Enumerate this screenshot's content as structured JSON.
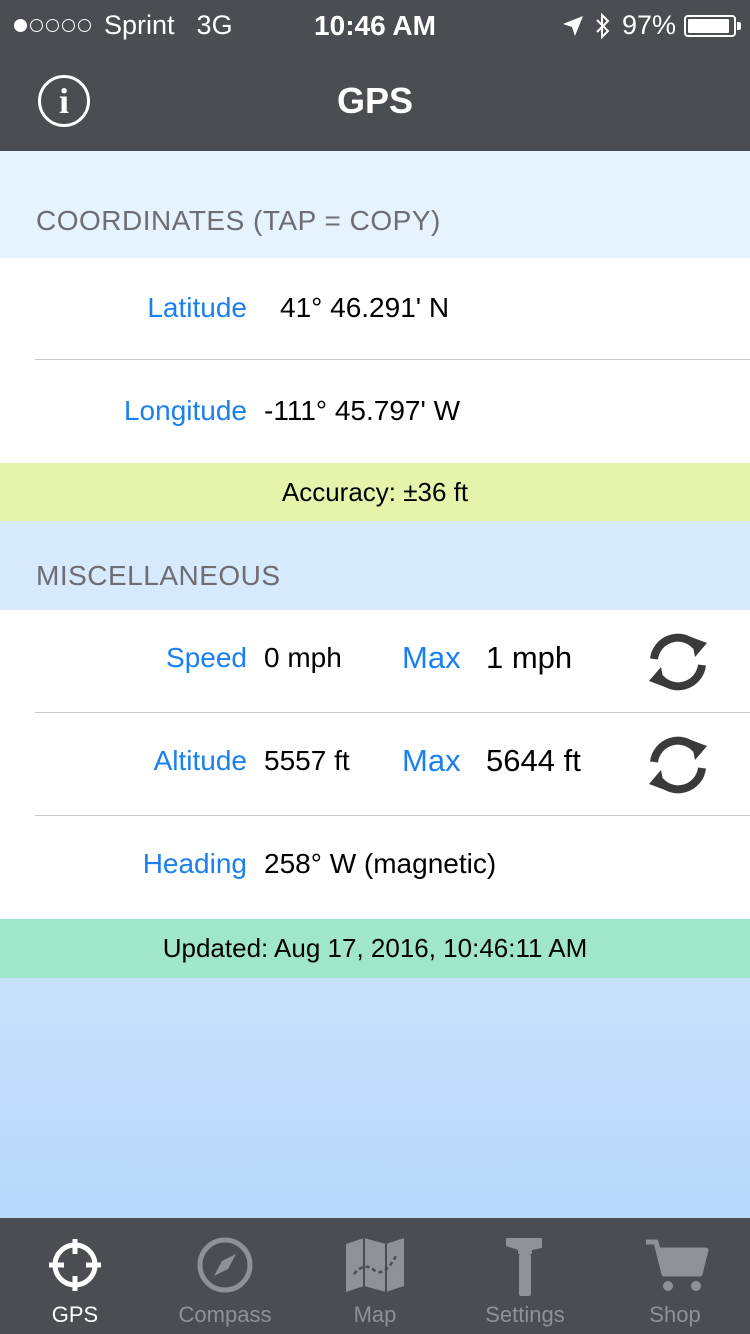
{
  "status_bar": {
    "carrier": "Sprint",
    "network": "3G",
    "time": "10:46 AM",
    "battery": "97%",
    "battery_level": 0.97,
    "signal_bars_filled": 1,
    "signal_bars_total": 5
  },
  "nav": {
    "title": "GPS",
    "info_icon": "info-icon"
  },
  "coordinates": {
    "header": "COORDINATES (TAP = COPY)",
    "latitude_label": "Latitude",
    "latitude_value": "41° 46.291' N",
    "longitude_label": "Longitude",
    "longitude_value": "-111° 45.797' W",
    "accuracy": "Accuracy: ±36 ft"
  },
  "misc": {
    "header": "MISCELLANEOUS",
    "speed_label": "Speed",
    "speed_value": "0 mph",
    "speed_max_label": "Max",
    "speed_max_value": "1 mph",
    "altitude_label": "Altitude",
    "altitude_value": "5557 ft",
    "altitude_max_label": "Max",
    "altitude_max_value": "5644 ft",
    "heading_label": "Heading",
    "heading_value": "258° W (magnetic)",
    "updated": "Updated: Aug 17, 2016, 10:46:11 AM"
  },
  "tabs": [
    {
      "label": "GPS",
      "icon": "crosshair-icon",
      "active": true
    },
    {
      "label": "Compass",
      "icon": "compass-icon",
      "active": false
    },
    {
      "label": "Map",
      "icon": "map-icon",
      "active": false
    },
    {
      "label": "Settings",
      "icon": "hammer-icon",
      "active": false
    },
    {
      "label": "Shop",
      "icon": "cart-icon",
      "active": false
    }
  ],
  "colors": {
    "accent": "#1a80f0",
    "bar": "#4a4d52",
    "accuracy_bg": "#e5f4ab",
    "updated_bg": "#9fe6cb"
  }
}
